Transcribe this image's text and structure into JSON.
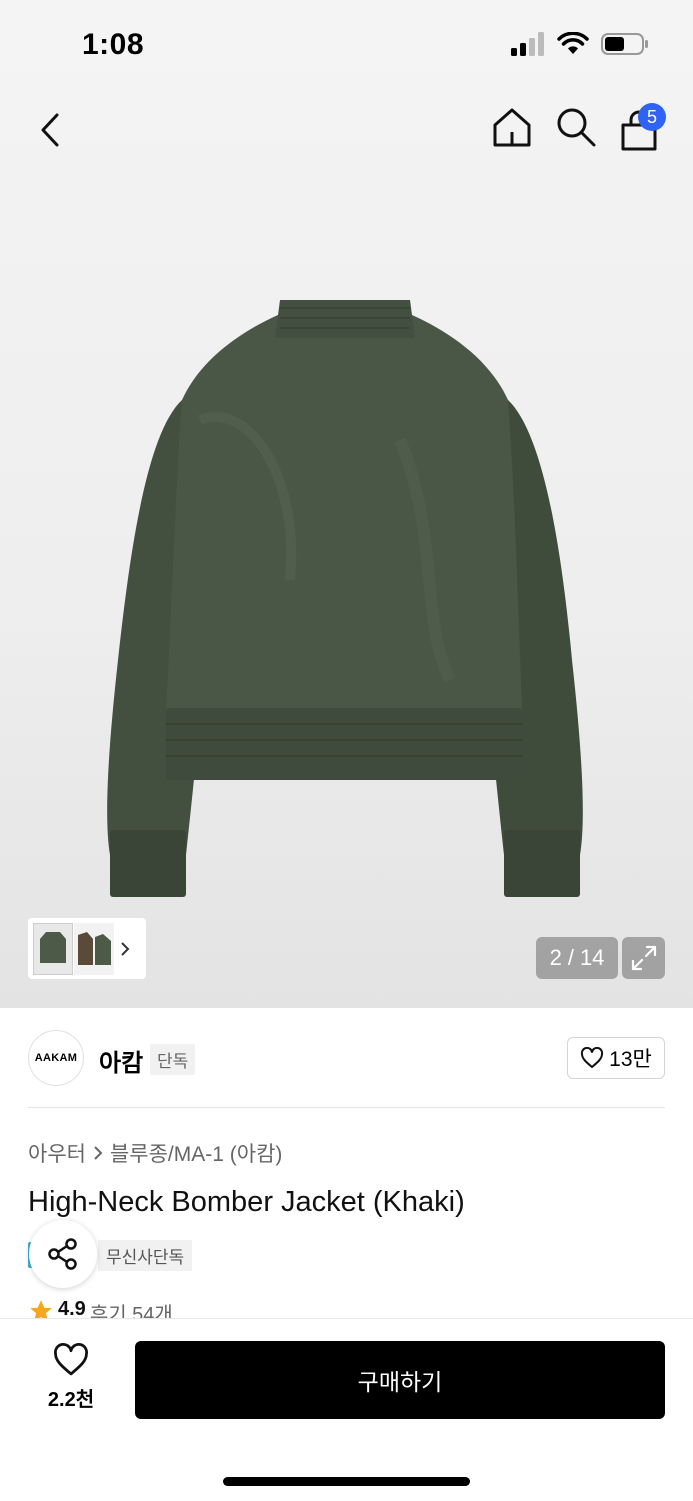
{
  "status_bar": {
    "time": "1:08"
  },
  "nav": {
    "cart_count": "5"
  },
  "gallery": {
    "counter_current": "2",
    "counter_separator": "/",
    "counter_total": "14"
  },
  "brand": {
    "logo_text": "AAKAM",
    "name": "아캄",
    "tag": "단독",
    "follow_count": "13만"
  },
  "breadcrumb": {
    "category": "아우터",
    "subcategory": "블루종/MA-1 (아캄)"
  },
  "product": {
    "title": "High-Neck Bomber Jacket (Khaki)",
    "exclusive_tag": "무신사단독",
    "rating": "4.9",
    "review_label": "후기 54개"
  },
  "bottom": {
    "like_count": "2.2천",
    "buy_label": "구매하기"
  },
  "colors": {
    "accent": "#2f63f5",
    "jacket": "#4a5646",
    "star": "#f5a623"
  }
}
